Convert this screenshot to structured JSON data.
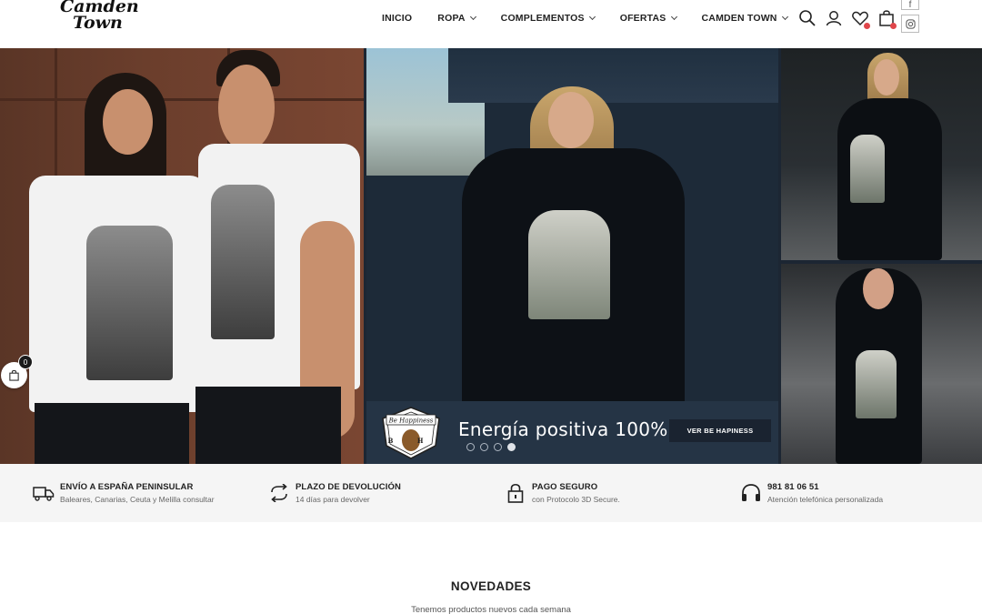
{
  "brand": {
    "line1": "Camden",
    "line2": "Town"
  },
  "nav": {
    "items": [
      {
        "label": "INICIO",
        "has_dropdown": false
      },
      {
        "label": "ROPA",
        "has_dropdown": true
      },
      {
        "label": "COMPLEMENTOS",
        "has_dropdown": true
      },
      {
        "label": "OFERTAS",
        "has_dropdown": true
      },
      {
        "label": "CAMDEN TOWN",
        "has_dropdown": true
      }
    ]
  },
  "header_icons": [
    "search-icon",
    "user-icon",
    "heart-icon",
    "bag-icon"
  ],
  "social": [
    "facebook-icon",
    "instagram-icon"
  ],
  "hero": {
    "badge_text": "Be Happiness",
    "badge_initials": "B H",
    "slide_text": "Energía positiva 100%",
    "cta_label": "VER BE HAPINESS",
    "slides_total": 4,
    "active_slide": 4
  },
  "cart": {
    "count": "0"
  },
  "features": [
    {
      "icon": "truck-icon",
      "title": "ENVÍO A ESPAÑA PENINSULAR",
      "subtitle": "Baleares, Canarias, Ceuta y Melilla consultar"
    },
    {
      "icon": "return-icon",
      "title": "PLAZO DE DEVOLUCIÓN",
      "subtitle": "14 días para devolver"
    },
    {
      "icon": "lock-icon",
      "title": "PAGO SEGURO",
      "subtitle": "con Protocolo 3D Secure."
    },
    {
      "icon": "headset-icon",
      "title": "981 81 06 51",
      "subtitle": "Atención telefónica personalizada"
    }
  ],
  "novedades": {
    "title": "NOVEDADES",
    "subtitle": "Tenemos productos nuevos cada semana"
  },
  "colors": {
    "banner": "#253445",
    "badge_red": "#e0464b",
    "feature_bg": "#f5f5f5"
  }
}
